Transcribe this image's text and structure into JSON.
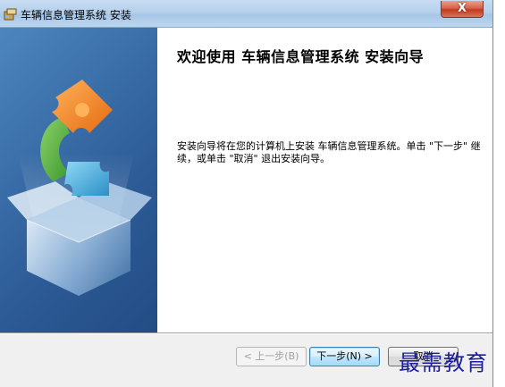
{
  "window": {
    "title": "车辆信息管理系统 安装",
    "close_label": "X"
  },
  "content": {
    "heading": "欢迎使用 车辆信息管理系统 安装向导",
    "body": "安装向导将在您的计算机上安装 车辆信息管理系统。单击 \"下一步\" 继续，或单击 \"取消\" 退出安装向导。"
  },
  "buttons": {
    "back_label": "< 上一步(B)",
    "next_label": "下一步(N) >",
    "cancel_label": "取消"
  },
  "watermark": {
    "text": "最需教育"
  },
  "icons": {
    "title_icon": "installer-package-icon",
    "banner_image": "puzzle-box-icon"
  },
  "colors": {
    "banner": "#3a6ea8",
    "close_button": "#c4391f",
    "primary_border": "#3c7fb1",
    "watermark": "#1c1c9c"
  }
}
